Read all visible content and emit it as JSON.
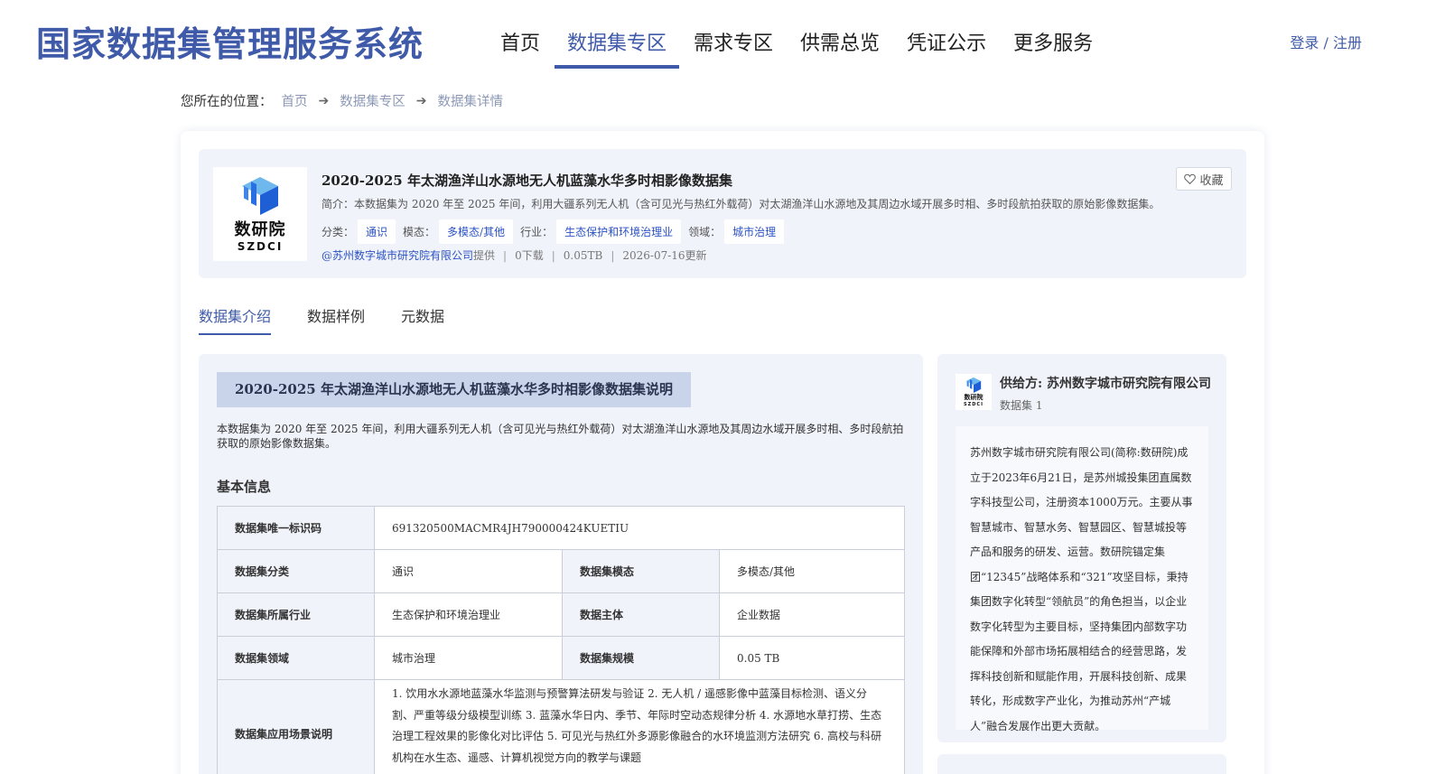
{
  "header": {
    "site_title": "国家数据集管理服务系统",
    "nav": [
      "首页",
      "数据集专区",
      "需求专区",
      "供需总览",
      "凭证公示",
      "更多服务"
    ],
    "login": "登录 / 注册"
  },
  "breadcrumb": {
    "label": "您所在的位置：",
    "items": [
      "首页",
      "数据集专区",
      "数据集详情"
    ]
  },
  "dataset": {
    "logo_cn": "数研院",
    "logo_en": "SZDCI",
    "title": "2020-2025 年太湖渔洋山水源地无人机蓝藻水华多时相影像数据集",
    "brief": "简介：本数据集为 2020 年至 2025 年间，利用大疆系列无人机（含可见光与热红外载荷）对太湖渔洋山水源地及其周边水域开展多时相、多时段航拍获取的原始影像数据集。",
    "tags": [
      {
        "label": "分类：",
        "value": "通识"
      },
      {
        "label": "模态：",
        "value": "多模态/其他"
      },
      {
        "label": "行业：",
        "value": "生态保护和环境治理业"
      },
      {
        "label": "领域：",
        "value": "城市治理"
      }
    ],
    "org": "@苏州数字城市研究院有限公司",
    "provided": "提供",
    "downloads": "0下载",
    "size": "0.05TB",
    "updated": "2026-07-16更新",
    "favorite": "收藏"
  },
  "tabs": [
    "数据集介绍",
    "数据样例",
    "元数据"
  ],
  "content": {
    "desc_title": "2020-2025 年太湖渔洋山水源地无人机蓝藻水华多时相影像数据集说明",
    "desc_text": "本数据集为 2020 年至 2025 年间，利用大疆系列无人机（含可见光与热红外载荷）对太湖渔洋山水源地及其周边水域开展多时相、多时段航拍获取的原始影像数据集。",
    "section_title": "基本信息",
    "table": {
      "uid_key": "数据集唯一标识码",
      "uid_val": "691320500MACMR4JH790000424KUETIU",
      "cat_key": "数据集分类",
      "cat_val": "通识",
      "mod_key": "数据集模态",
      "mod_val": "多模态/其他",
      "ind_key": "数据集所属行业",
      "ind_val": "生态保护和环境治理业",
      "sub_key": "数据主体",
      "sub_val": "企业数据",
      "dom_key": "数据集领域",
      "dom_val": "城市治理",
      "scale_key": "数据集规模",
      "scale_val": "0.05 TB",
      "scene_key": "数据集应用场景说明",
      "scene_val": "1. 饮用水水源地蓝藻水华监测与预警算法研发与验证 2. 无人机 / 遥感影像中蓝藻目标检测、语义分割、严重等级分级模型训练 3. 蓝藻水华日内、季节、年际时空动态规律分析 4. 水源地水草打捞、生态治理工程效果的影像化对比评估 5. 可见光与热红外多源影像融合的水环境监测方法研究 6. 高校与科研机构在水生态、遥感、计算机视觉方向的教学与课题"
    }
  },
  "provider": {
    "name": "供给方: 苏州数字城市研究院有限公司",
    "count": "数据集 1",
    "logo_cn": "数研院",
    "logo_en": "SZDCI",
    "intro": "苏州数字城市研究院有限公司(简称:数研院)成立于2023年6月21日，是苏州城投集团直属数字科技型公司，注册资本1000万元。主要从事智慧城市、智慧水务、智慧园区、智慧城投等产品和服务的研发、运营。数研院锚定集团“12345”战略体系和“321”攻坚目标，秉持集团数字化转型“领航员”的角色担当，以企业数字化转型为主要目标，坚持集团内部数字功能保障和外部市场拓展相结合的经营思路，发挥科技创新和赋能作用，开展科技创新、成果转化，形成数字产业化，为推动苏州“产城人”融合发展作出更大贡献。"
  },
  "colors": {
    "brand": "#3f5aa8",
    "tag_text": "#2b52c4",
    "panel_bg": "#f0f3fa"
  }
}
